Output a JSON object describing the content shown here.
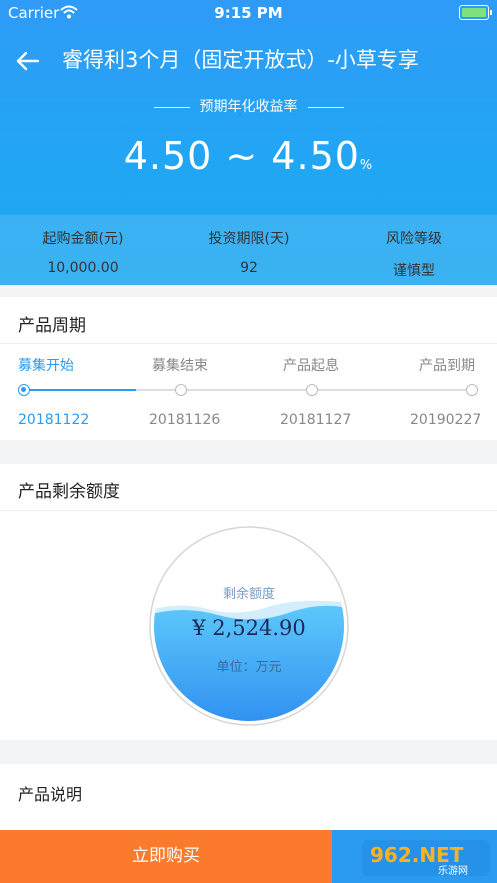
{
  "status_bar": {
    "carrier": "Carrier",
    "time": "9:15 PM"
  },
  "header": {
    "title": "睿得利3个月（固定开放式）-小草专享",
    "rate_label": "预期年化收益率",
    "rate": "4.50 ~ 4.50",
    "rate_unit": "%"
  },
  "info": {
    "items": [
      {
        "label": "起购金额(元)",
        "value": "10,000.00"
      },
      {
        "label": "投资期限(天)",
        "value": "92"
      },
      {
        "label": "风险等级",
        "value": "谨慎型"
      }
    ]
  },
  "cycle": {
    "title": "产品周期",
    "steps": [
      {
        "label": "募集开始",
        "date": "20181122"
      },
      {
        "label": "募集结束",
        "date": "20181126"
      },
      {
        "label": "产品起息",
        "date": "20181127"
      },
      {
        "label": "产品到期",
        "date": "20190227"
      }
    ],
    "active_step": 0
  },
  "remaining": {
    "title": "产品剩余额度",
    "gauge_label": "剩余额度",
    "amount": "¥ 2,524.90",
    "unit": "单位：万元"
  },
  "description": {
    "title": "产品说明"
  },
  "bottom": {
    "buy_label": "立即购买"
  },
  "watermark": {
    "text": "962.NET",
    "sub": "乐游网"
  },
  "colors": {
    "primary": "#2a9bf2",
    "buy": "#fb7a2c",
    "header": "#2f9bf7"
  }
}
